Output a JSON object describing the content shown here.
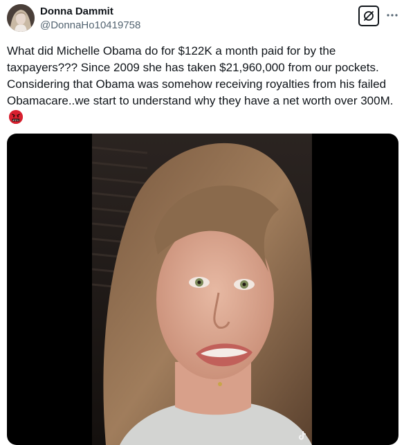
{
  "tweet": {
    "author": {
      "display_name": "Donna Dammit",
      "handle": "@DonnaHo10419758"
    },
    "text": "What did Michelle Obama do for $122K a month paid for by the taxpayers??? Since 2009 she has taken $21,960,000 from our pockets. Considering that Obama was somehow receiving royalties from his failed Obamacare..we start to understand why they have a net worth over 300M.",
    "emoji": "angry-face-with-symbols",
    "media": {
      "type": "video",
      "watermark": "tiktok-icon"
    }
  },
  "icons": {
    "grok": "grok-icon",
    "more": "more-icon"
  },
  "colors": {
    "text": "#0f1419",
    "secondary": "#536471",
    "media_background": "#000000",
    "emoji": "#d9202f"
  }
}
